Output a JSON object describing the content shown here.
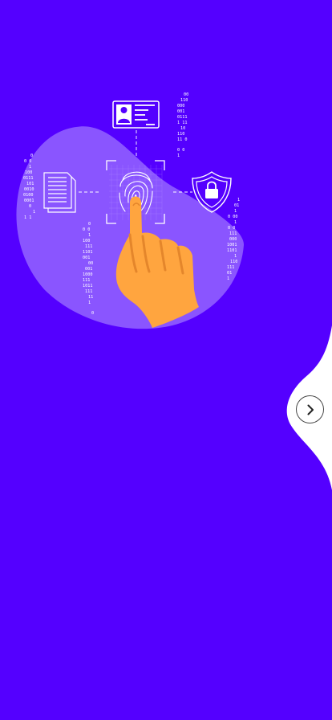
{
  "theme": {
    "background": "#5400ff",
    "blob": "#8a55ff",
    "hand": "#ffa53f",
    "hand_shadow": "#e4862b",
    "wave": "#ffffff"
  },
  "illustration": {
    "subject": "fingerprint-biometric-scan",
    "icons": [
      "id-card-icon",
      "document-icon",
      "fingerprint-icon",
      "shield-lock-icon",
      "pointing-hand-icon"
    ]
  },
  "navigation": {
    "next_icon": "chevron-right-icon"
  }
}
